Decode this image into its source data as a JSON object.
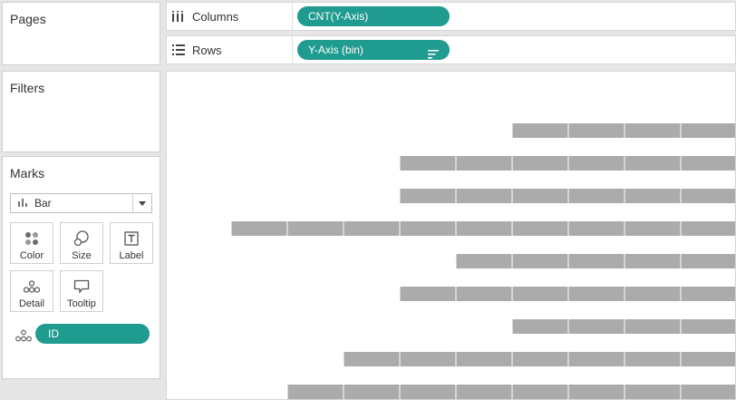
{
  "pages": {
    "title": "Pages"
  },
  "filters": {
    "title": "Filters"
  },
  "marks": {
    "title": "Marks",
    "mark_type": "Bar",
    "buttons": [
      "Color",
      "Size",
      "Label",
      "Detail",
      "Tooltip"
    ],
    "field": "ID"
  },
  "columns": {
    "label": "Columns",
    "pill": "CNT(Y-Axis)"
  },
  "rows": {
    "label": "Rows",
    "pill": "Y-Axis (bin)"
  },
  "colors": {
    "pill": "#1f9b8f",
    "bar": "#ababab"
  },
  "chart_data": {
    "type": "bar",
    "orientation": "horizontal",
    "note": "bars are stacked from segments by ID detail; values are segment counts read off the view",
    "values": [
      4,
      6,
      6,
      9,
      5,
      6,
      4,
      7,
      8
    ]
  }
}
